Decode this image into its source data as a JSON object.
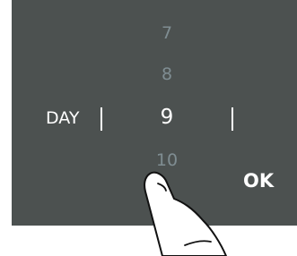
{
  "picker": {
    "label": "DAY",
    "values": [
      "7",
      "8",
      "9",
      "10"
    ],
    "selected_value": "9"
  },
  "actions": {
    "ok_label": "OK"
  },
  "colors": {
    "panel": "#4c5150",
    "text": "#ffffff",
    "dim_text": "#7f8d92"
  },
  "icons": {
    "pointer": "hand-pointer-icon"
  }
}
